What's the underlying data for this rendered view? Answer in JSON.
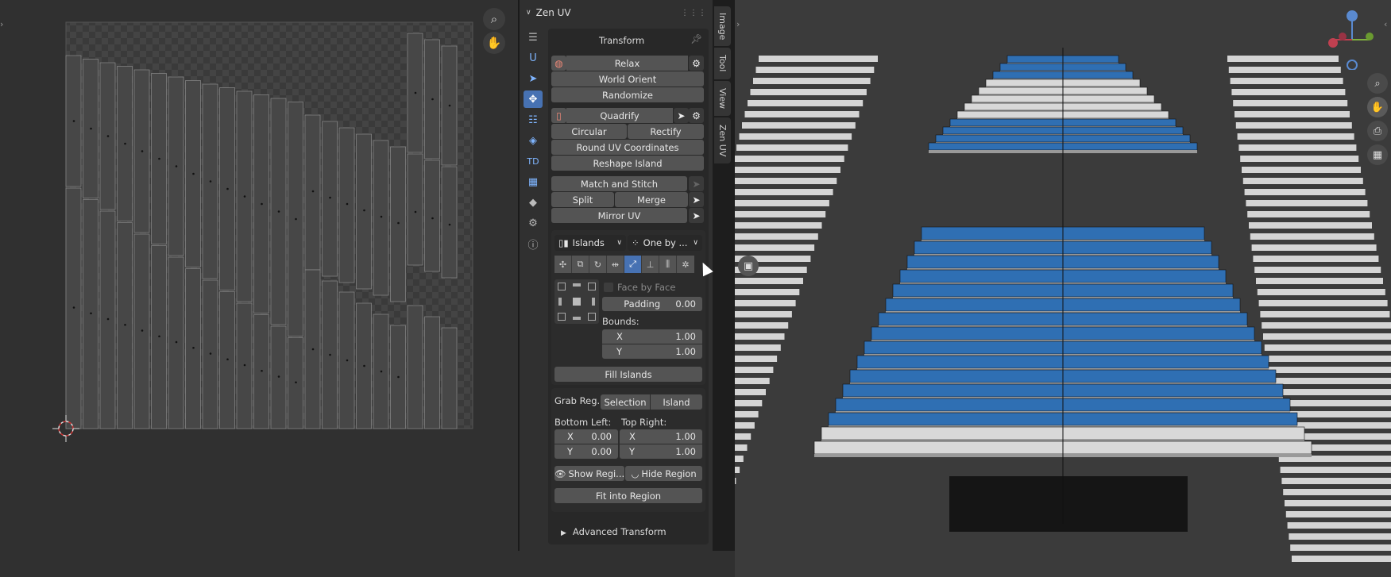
{
  "panel": {
    "title": "Zen UV",
    "transform_title": "Transform",
    "relax": "Relax",
    "world_orient": "World Orient",
    "randomize": "Randomize",
    "quadrify": "Quadrify",
    "circular": "Circular",
    "rectify": "Rectify",
    "round_uv": "Round UV Coordinates",
    "reshape_island": "Reshape Island",
    "match_stitch": "Match and Stitch",
    "split": "Split",
    "merge": "Merge",
    "mirror_uv": "Mirror UV",
    "mode_select": "Islands",
    "order_select": "One by ...",
    "face_by_face": "Face by Face",
    "padding_label": "Padding",
    "padding_value": "0.00",
    "bounds_label": "Bounds:",
    "bounds_x_label": "X",
    "bounds_x": "1.00",
    "bounds_y_label": "Y",
    "bounds_y": "1.00",
    "fill_islands": "Fill Islands",
    "grab_region": "Grab Reg...",
    "selection": "Selection",
    "island": "Island",
    "bottom_left": "Bottom Left:",
    "top_right": "Top Right:",
    "bl_x_label": "X",
    "bl_x": "0.00",
    "bl_y_label": "Y",
    "bl_y": "0.00",
    "tr_x_label": "X",
    "tr_x": "1.00",
    "tr_y_label": "Y",
    "tr_y": "1.00",
    "show_region": "Show Regi...",
    "hide_region": "Hide Region",
    "fit_region": "Fit into Region",
    "advanced_transform": "Advanced Transform"
  },
  "side_icons": [
    "list-icon",
    "u-icon",
    "select-icon",
    "transform-icon",
    "stack-icon",
    "layers-icon",
    "td-icon",
    "checker-icon",
    "box-icon",
    "gear-icon",
    "help-icon"
  ],
  "side_icon_text": {
    "u": "U",
    "td": "TD"
  },
  "tabs": [
    "Image",
    "Tool",
    "View",
    "Zen UV"
  ],
  "colors": {
    "accent": "#4772b3",
    "stair_blue": "#2f6fb3",
    "panel_bg": "#303030"
  }
}
